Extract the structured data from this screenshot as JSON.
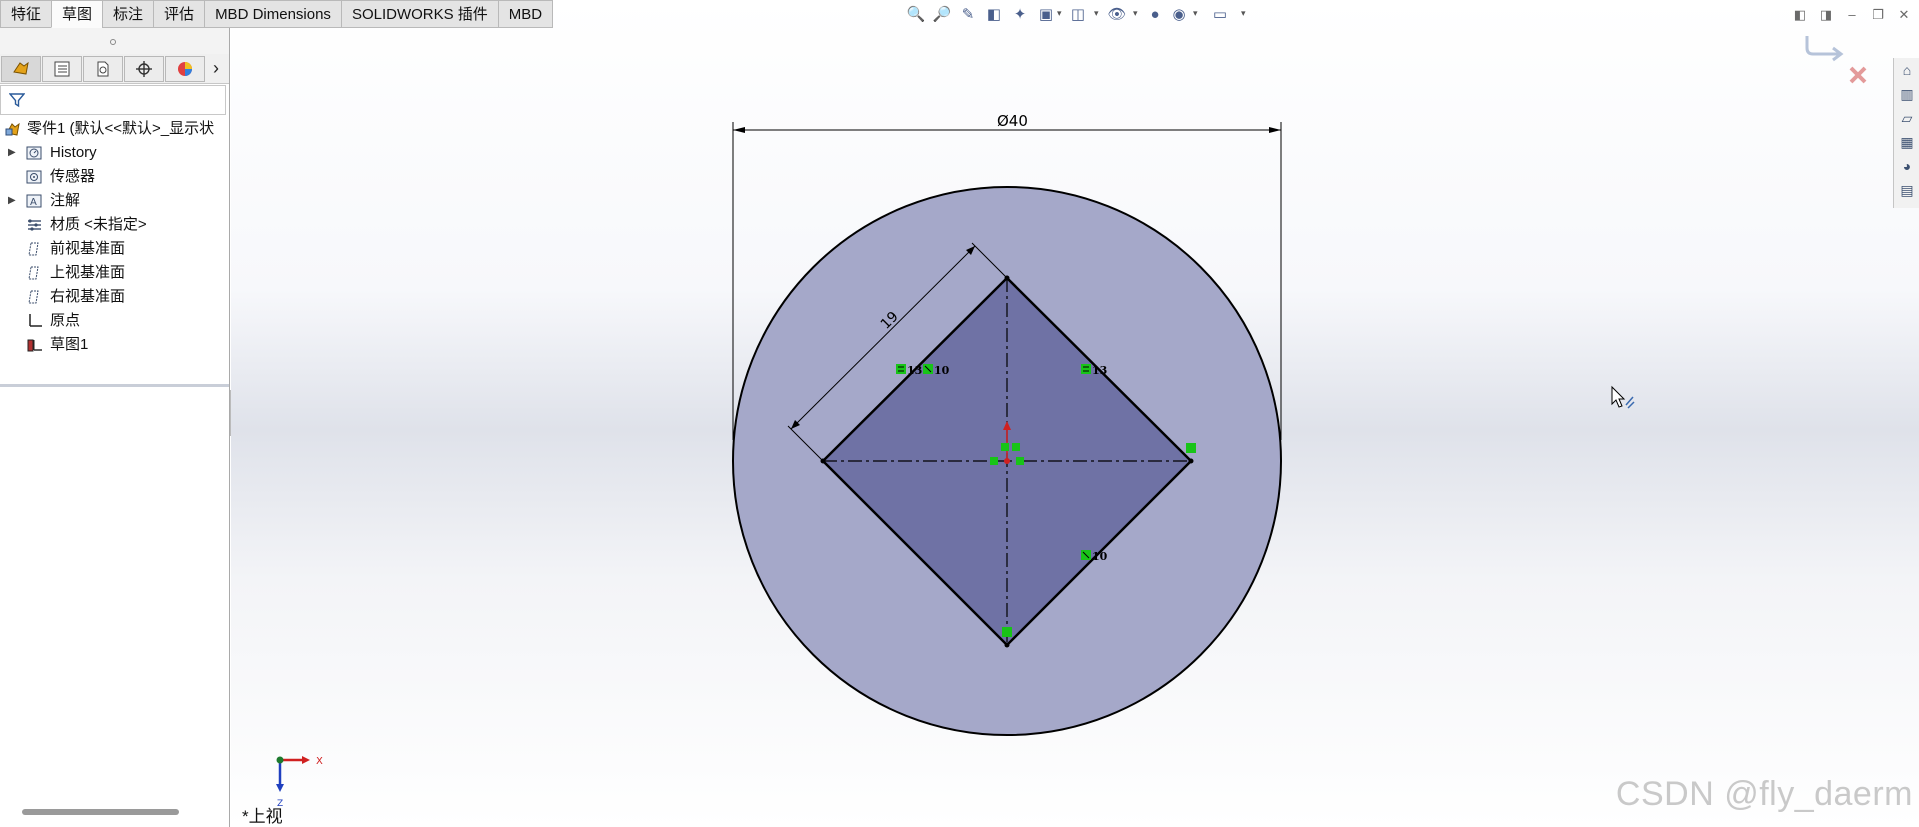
{
  "command_tabs": [
    "特征",
    "草图",
    "标注",
    "评估",
    "MBD Dimensions",
    "SOLIDWORKS 插件",
    "MBD"
  ],
  "active_tab_index": 1,
  "feature_tree": {
    "root": "零件1 (默认<<默认>_显示状",
    "items": [
      {
        "label": "History",
        "icon": "history-icon",
        "expandable": true
      },
      {
        "label": "传感器",
        "icon": "sensor-icon",
        "expandable": false
      },
      {
        "label": "注解",
        "icon": "annotations-icon",
        "expandable": true
      },
      {
        "label": "材质 <未指定>",
        "icon": "material-icon",
        "expandable": false
      },
      {
        "label": "前视基准面",
        "icon": "plane-icon",
        "expandable": false
      },
      {
        "label": "上视基准面",
        "icon": "plane-icon",
        "expandable": false
      },
      {
        "label": "右视基准面",
        "icon": "plane-icon",
        "expandable": false
      },
      {
        "label": "原点",
        "icon": "origin-icon",
        "expandable": false
      },
      {
        "label": "草图1",
        "icon": "sketch-icon",
        "expandable": false
      }
    ]
  },
  "sketch": {
    "diameter_dim": "Ø40",
    "side_dim": "19",
    "relation_labels": [
      "13",
      "10",
      "13",
      "10"
    ]
  },
  "triad": {
    "x": "X",
    "z": "Z"
  },
  "view_name": "*上视",
  "watermark": "CSDN @fly_daerm",
  "colors": {
    "circle_fill": "#a5a8c9",
    "square_fill": "#6f72a5",
    "relation_green": "#18c418",
    "dim_line": "#000000",
    "triad_x": "#d02020",
    "triad_z": "#1f3fbf"
  }
}
